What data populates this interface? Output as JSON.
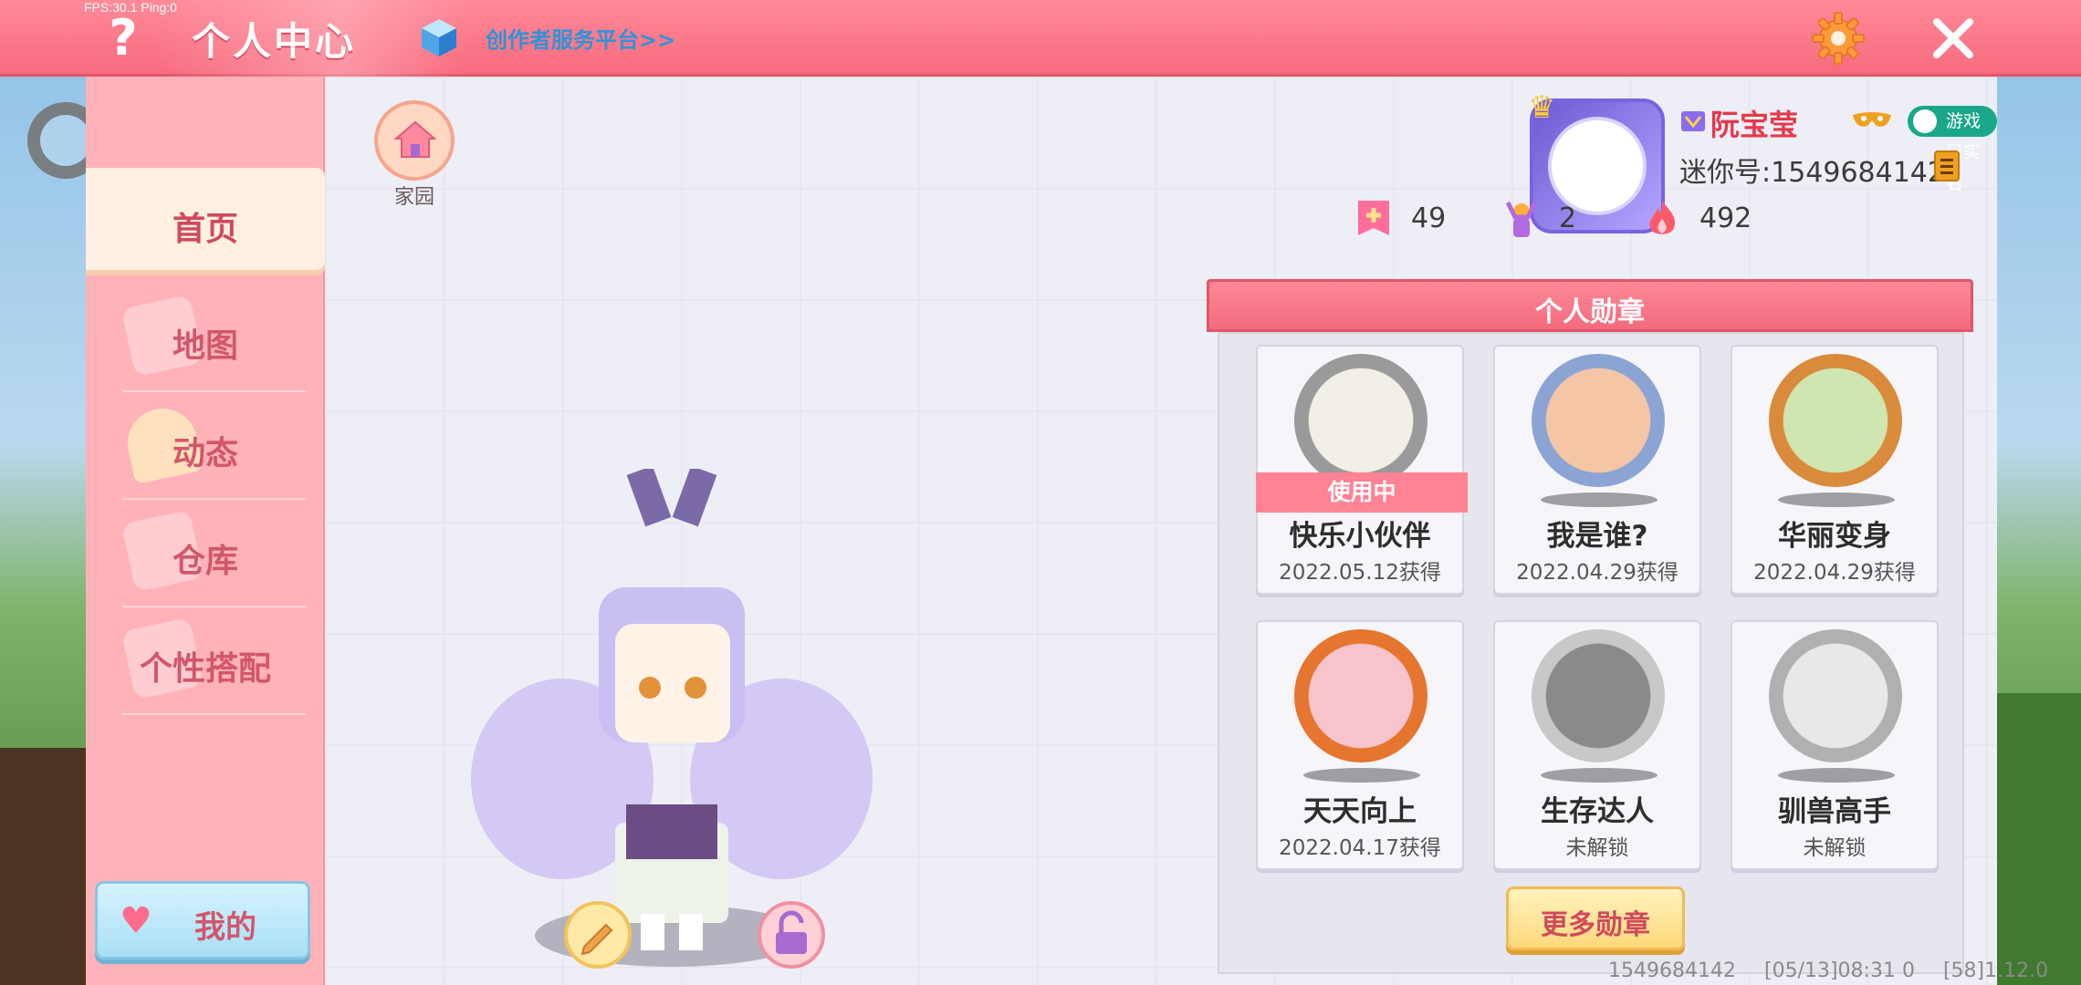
{
  "overlay": {
    "fps": "FPS:30.1  Ping:0"
  },
  "header": {
    "help_glyph": "?",
    "title": "个人中心",
    "creator_link": "创作者服务平台>>",
    "settings_icon": "gear-icon",
    "close_icon": "close-icon"
  },
  "sidebar": {
    "items": [
      {
        "label": "首页",
        "active": true
      },
      {
        "label": "地图",
        "active": false
      },
      {
        "label": "动态",
        "active": false
      },
      {
        "label": "仓库",
        "active": false
      },
      {
        "label": "个性搭配",
        "active": false
      }
    ],
    "my_button": "我的"
  },
  "home": {
    "label": "家园"
  },
  "profile": {
    "nickname": "阮宝莹",
    "realname_badge": "游戏已实名",
    "mini_id": "迷你号:1549684142",
    "stats": {
      "plus": "49",
      "cheer": "2",
      "flame": "492"
    }
  },
  "medals": {
    "title": "个人勋章",
    "items": [
      {
        "name": "快乐小伙伴",
        "sub": "2022.05.12获得",
        "tag": "使用中"
      },
      {
        "name": "我是谁?",
        "sub": "2022.04.29获得"
      },
      {
        "name": "华丽变身",
        "sub": "2022.04.29获得"
      },
      {
        "name": "天天向上",
        "sub": "2022.04.17获得"
      },
      {
        "name": "生存达人",
        "sub": "未解锁"
      },
      {
        "name": "驯兽高手",
        "sub": "未解锁"
      }
    ],
    "more_button": "更多勋章"
  },
  "footer": {
    "uid": "1549684142",
    "time": "[05/13]08:31 0",
    "version": "[58]1.12.0"
  },
  "colors": {
    "header": "#f76b7e",
    "sidebar": "#ffb3b9",
    "accent_text": "#d2576a",
    "realname": "#1aa789"
  }
}
